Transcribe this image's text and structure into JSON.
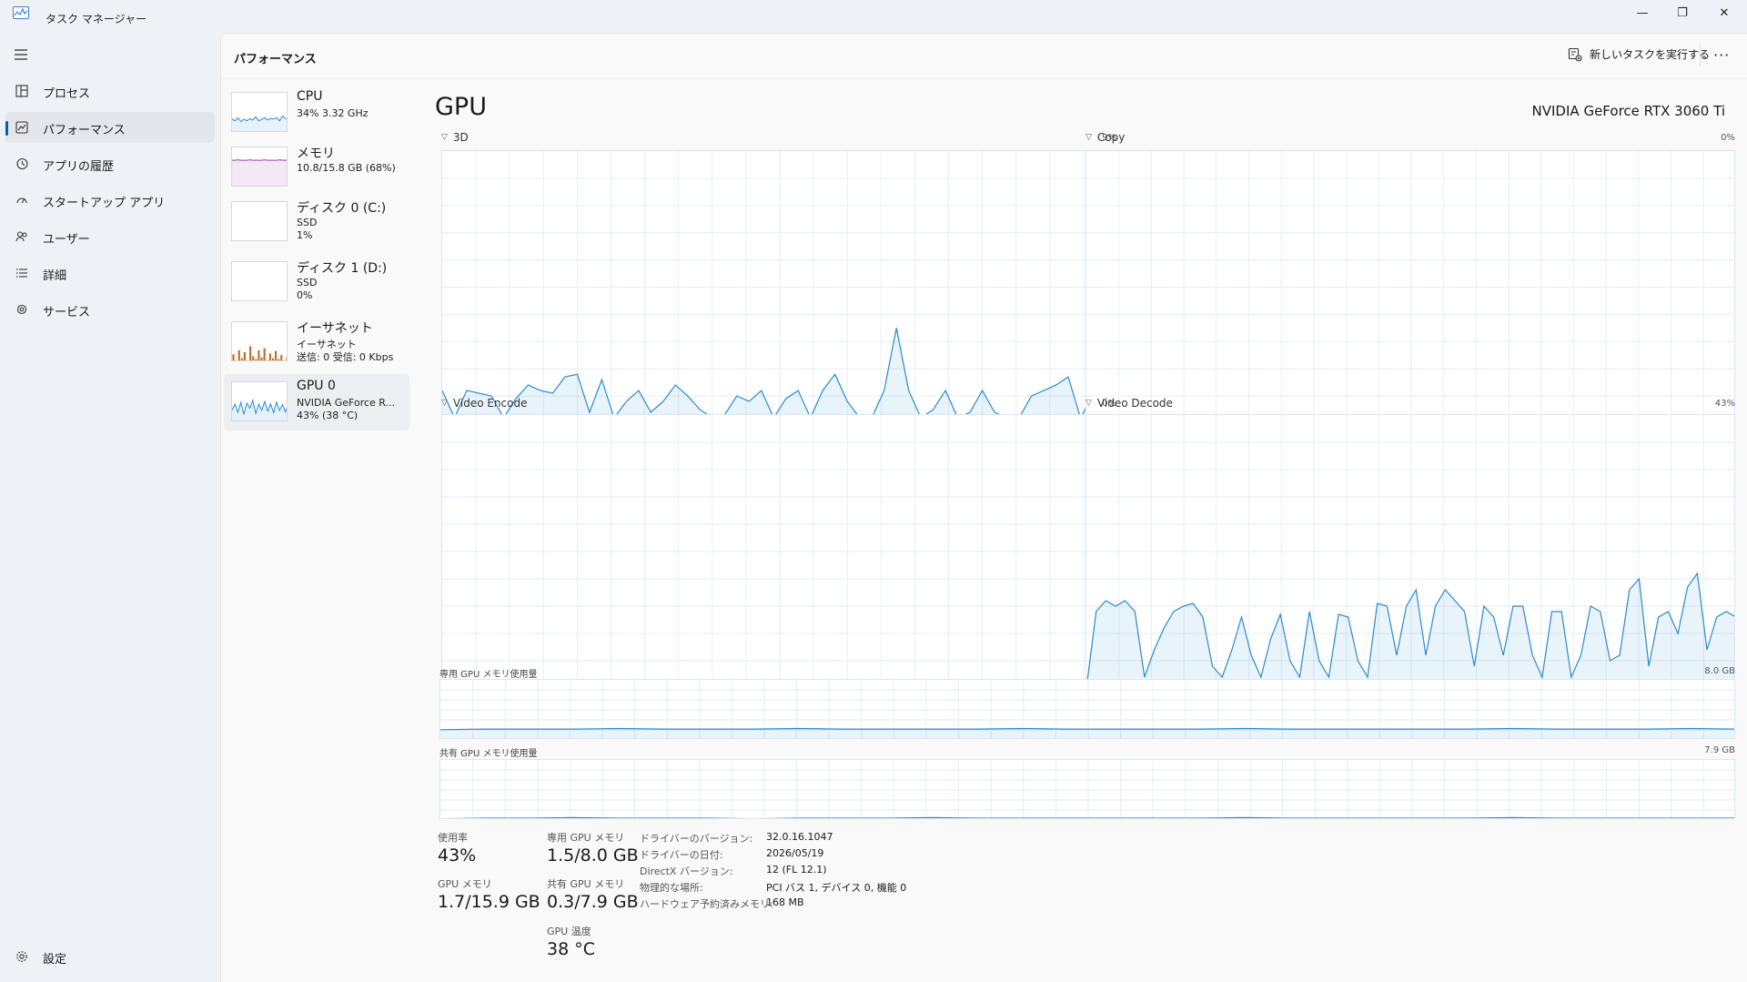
{
  "app": {
    "title": "タスク マネージャー"
  },
  "window_controls": {
    "minimize": "—",
    "restore": "❐",
    "close": "✕"
  },
  "nav": {
    "items": [
      {
        "label": "プロセス",
        "icon": "processes-icon"
      },
      {
        "label": "パフォーマンス",
        "icon": "performance-icon"
      },
      {
        "label": "アプリの履歴",
        "icon": "app-history-icon"
      },
      {
        "label": "スタートアップ アプリ",
        "icon": "startup-icon"
      },
      {
        "label": "ユーザー",
        "icon": "users-icon"
      },
      {
        "label": "詳細",
        "icon": "details-icon"
      },
      {
        "label": "サービス",
        "icon": "services-icon"
      }
    ],
    "settings_label": "設定"
  },
  "header": {
    "title": "パフォーマンス",
    "run_task_label": "新しいタスクを実行する",
    "more_label": "···"
  },
  "devices": [
    {
      "name": "CPU",
      "line1": "34%  3.32 GHz",
      "line2": ""
    },
    {
      "name": "メモリ",
      "line1": "10.8/15.8 GB (68%)",
      "line2": ""
    },
    {
      "name": "ディスク 0 (C:)",
      "line1": "SSD",
      "line2": "1%"
    },
    {
      "name": "ディスク 1 (D:)",
      "line1": "SSD",
      "line2": "0%"
    },
    {
      "name": "イーサネット",
      "line1": "イーサネット",
      "line2": "送信: 0 受信: 0 Kbps"
    },
    {
      "name": "GPU 0",
      "line1": "NVIDIA GeForce R...",
      "line2": "43%  (38 °C)"
    }
  ],
  "colors": {
    "cpu": "#2f8bd6",
    "memory": "#a13bb8",
    "disk": "#4caf2a",
    "ethernet": "#c46a1f",
    "gpu": "#2a8ad0",
    "accent": "#005fb8"
  },
  "gpu": {
    "title": "GPU",
    "model": "NVIDIA GeForce RTX 3060 Ti",
    "engines": [
      {
        "label": "3D",
        "max": "9%"
      },
      {
        "label": "Copy",
        "max": "0%"
      },
      {
        "label": "Video Encode",
        "max": "0%"
      },
      {
        "label": "Video Decode",
        "max": "43%"
      }
    ],
    "dedicated_label": "専用 GPU メモリ使用量",
    "dedicated_max": "8.0 GB",
    "shared_label": "共有 GPU メモリ使用量",
    "shared_max": "7.9 GB",
    "stats": {
      "utilization_label": "使用率",
      "utilization_value": "43%",
      "gpu_mem_label": "GPU メモリ",
      "gpu_mem_value": "1.7/15.9 GB",
      "dedicated_mem_label": "専用 GPU メモリ",
      "dedicated_mem_value": "1.5/8.0 GB",
      "shared_mem_label": "共有 GPU メモリ",
      "shared_mem_value": "0.3/7.9 GB",
      "temp_label": "GPU 温度",
      "temp_value": "38 °C"
    },
    "info": [
      {
        "key": "ドライバーのバージョン:",
        "value": "32.0.16.1047"
      },
      {
        "key": "ドライバーの日付:",
        "value": "2026/05/19"
      },
      {
        "key": "DirectX バージョン:",
        "value": "12 (FL 12.1)"
      },
      {
        "key": "物理的な場所:",
        "value": "PCI バス 1, デバイス 0, 機能 0"
      },
      {
        "key": "ハードウェア予約済みメモリ:",
        "value": "168 MB"
      }
    ]
  },
  "series": {
    "gpu_3d": [
      12,
      2,
      12,
      11,
      10,
      2,
      9,
      14,
      12,
      11,
      17,
      18,
      4,
      16,
      2,
      8,
      12,
      4,
      8,
      14,
      10,
      5,
      2,
      3,
      10,
      8,
      12,
      2,
      9,
      12,
      2,
      12,
      18,
      8,
      2,
      2,
      12,
      35,
      12,
      2,
      5,
      12,
      2,
      4,
      12,
      4,
      2,
      2,
      10,
      12,
      14,
      17,
      2,
      10,
      12,
      10
    ],
    "gpu_copy": [
      0,
      0,
      0,
      0,
      0,
      0,
      0,
      0,
      0,
      0,
      0,
      0,
      0,
      0,
      0,
      0,
      0,
      0,
      0,
      1,
      1,
      0,
      0,
      0,
      0,
      0,
      0,
      0,
      1,
      0,
      0,
      0,
      0,
      0,
      0,
      0,
      0,
      1,
      0,
      0
    ],
    "gpu_decode": [
      0,
      28,
      32,
      30,
      32,
      28,
      4,
      14,
      22,
      28,
      30,
      31,
      26,
      8,
      4,
      14,
      26,
      12,
      4,
      18,
      27,
      10,
      4,
      28,
      10,
      4,
      27,
      26,
      10,
      4,
      31,
      30,
      12,
      30,
      36,
      12,
      30,
      36,
      32,
      28,
      8,
      30,
      26,
      12,
      30,
      30,
      12,
      4,
      28,
      28,
      4,
      12,
      30,
      28,
      10,
      12,
      36,
      40,
      8,
      26,
      28,
      20,
      37,
      42,
      14,
      26,
      28,
      26
    ],
    "dedicated_mem": [
      0.17,
      0.18,
      0.18,
      0.18,
      0.19,
      0.18,
      0.18,
      0.18,
      0.19,
      0.18,
      0.18,
      0.18,
      0.18,
      0.19,
      0.18,
      0.18,
      0.18,
      0.18,
      0.19,
      0.18,
      0.18,
      0.18,
      0.18,
      0.18,
      0.19,
      0.18,
      0.18,
      0.18,
      0.19,
      0.18
    ],
    "shared_mem": [
      0.02,
      0.03,
      0.03,
      0.04,
      0.03,
      0.03,
      0.03,
      0.02,
      0.03,
      0.03,
      0.03,
      0.04,
      0.03,
      0.03,
      0.03,
      0.03,
      0.03,
      0.03,
      0.04,
      0.03,
      0.03,
      0.03,
      0.03,
      0.03,
      0.04,
      0.03,
      0.03,
      0.03,
      0.03,
      0.03
    ],
    "thumb_cpu": [
      35,
      30,
      38,
      28,
      34,
      30,
      36,
      32,
      40,
      30,
      34,
      38,
      32,
      36,
      34,
      38,
      30,
      42,
      36,
      34
    ],
    "thumb_mem": [
      68,
      68,
      69,
      68,
      68,
      68,
      69,
      68,
      68,
      68,
      68,
      69,
      68,
      68,
      68,
      68,
      69,
      68,
      68,
      68
    ],
    "thumb_disk": [
      0,
      0,
      0,
      2,
      0,
      1,
      0,
      0,
      3,
      0,
      1,
      0,
      0,
      0,
      2,
      0,
      0,
      1,
      0,
      0
    ],
    "thumb_eth": [
      20,
      5,
      30,
      10,
      25,
      5,
      40,
      15,
      8,
      30,
      12,
      35,
      6,
      22,
      10,
      28,
      8,
      18,
      5,
      12
    ],
    "thumb_gpu": [
      30,
      45,
      25,
      50,
      20,
      48,
      35,
      55,
      22,
      45,
      30,
      52,
      28,
      46,
      24,
      50,
      30,
      44,
      26,
      48
    ]
  }
}
